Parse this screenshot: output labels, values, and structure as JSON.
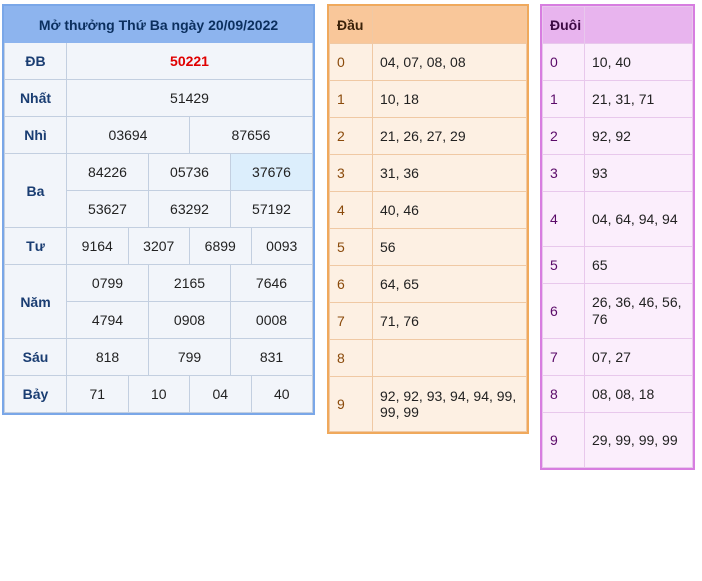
{
  "results": {
    "title": "Mở thưởng Thứ Ba ngày 20/09/2022",
    "db": {
      "label": "ĐB",
      "values": [
        "50221"
      ]
    },
    "nhat": {
      "label": "Nhất",
      "values": [
        "51429"
      ]
    },
    "nhi": {
      "label": "Nhì",
      "values": [
        "03694",
        "87656"
      ]
    },
    "ba": {
      "label": "Ba",
      "values": [
        "84226",
        "05736",
        "37676",
        "53627",
        "63292",
        "57192"
      ]
    },
    "tu": {
      "label": "Tư",
      "values": [
        "9164",
        "3207",
        "6899",
        "0093"
      ]
    },
    "nam": {
      "label": "Năm",
      "values": [
        "0799",
        "2165",
        "7646",
        "4794",
        "0908",
        "0008"
      ]
    },
    "sau": {
      "label": "Sáu",
      "values": [
        "818",
        "799",
        "831"
      ]
    },
    "bay": {
      "label": "Bảy",
      "values": [
        "71",
        "10",
        "04",
        "40"
      ]
    }
  },
  "dau": {
    "header": "Đầu",
    "rows": [
      {
        "key": "0",
        "value": "04, 07, 08, 08"
      },
      {
        "key": "1",
        "value": "10, 18"
      },
      {
        "key": "2",
        "value": "21, 26, 27, 29"
      },
      {
        "key": "3",
        "value": "31, 36"
      },
      {
        "key": "4",
        "value": "40, 46"
      },
      {
        "key": "5",
        "value": "56"
      },
      {
        "key": "6",
        "value": "64, 65"
      },
      {
        "key": "7",
        "value": "71, 76"
      },
      {
        "key": "8",
        "value": ""
      },
      {
        "key": "9",
        "value": "92, 92, 93, 94, 94, 99, 99, 99"
      }
    ]
  },
  "duoi": {
    "header": "Đuôi",
    "rows": [
      {
        "key": "0",
        "value": "10, 40"
      },
      {
        "key": "1",
        "value": "21, 31, 71"
      },
      {
        "key": "2",
        "value": "92, 92"
      },
      {
        "key": "3",
        "value": "93"
      },
      {
        "key": "4",
        "value": "04, 64, 94, 94"
      },
      {
        "key": "5",
        "value": "65"
      },
      {
        "key": "6",
        "value": "26, 36, 46, 56, 76"
      },
      {
        "key": "7",
        "value": "07, 27"
      },
      {
        "key": "8",
        "value": "08, 08, 18"
      },
      {
        "key": "9",
        "value": "29, 99, 99, 99"
      }
    ]
  }
}
